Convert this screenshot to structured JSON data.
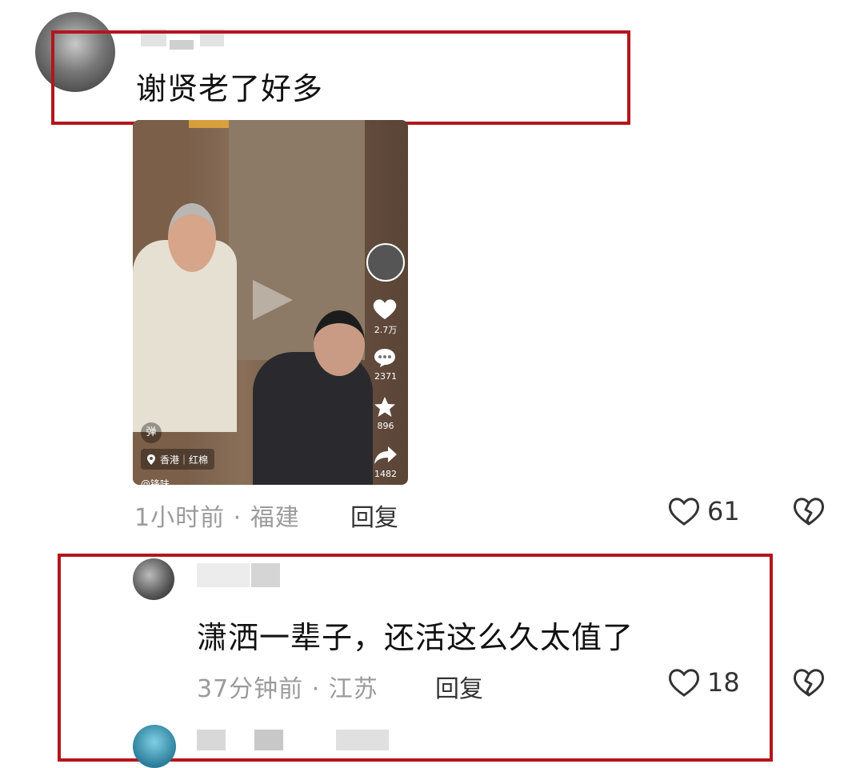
{
  "comment1": {
    "text": "谢贤老了好多",
    "meta": "1小时前 · 福建",
    "reply_label": "回复",
    "likes": "61"
  },
  "video": {
    "location": "香港｜红棉",
    "danmaku_label": "弹",
    "handle": "@锋味",
    "stats": {
      "likes": "2.7万",
      "comments": "2371",
      "favorites": "896",
      "shares": "1482"
    }
  },
  "comment2": {
    "text": "潇洒一辈子，还活这么久太值了",
    "meta": "37分钟前 · 江苏",
    "reply_label": "回复",
    "likes": "18"
  },
  "colors": {
    "highlight_border": "#b3161b",
    "meta_text": "#9b9b9b"
  }
}
